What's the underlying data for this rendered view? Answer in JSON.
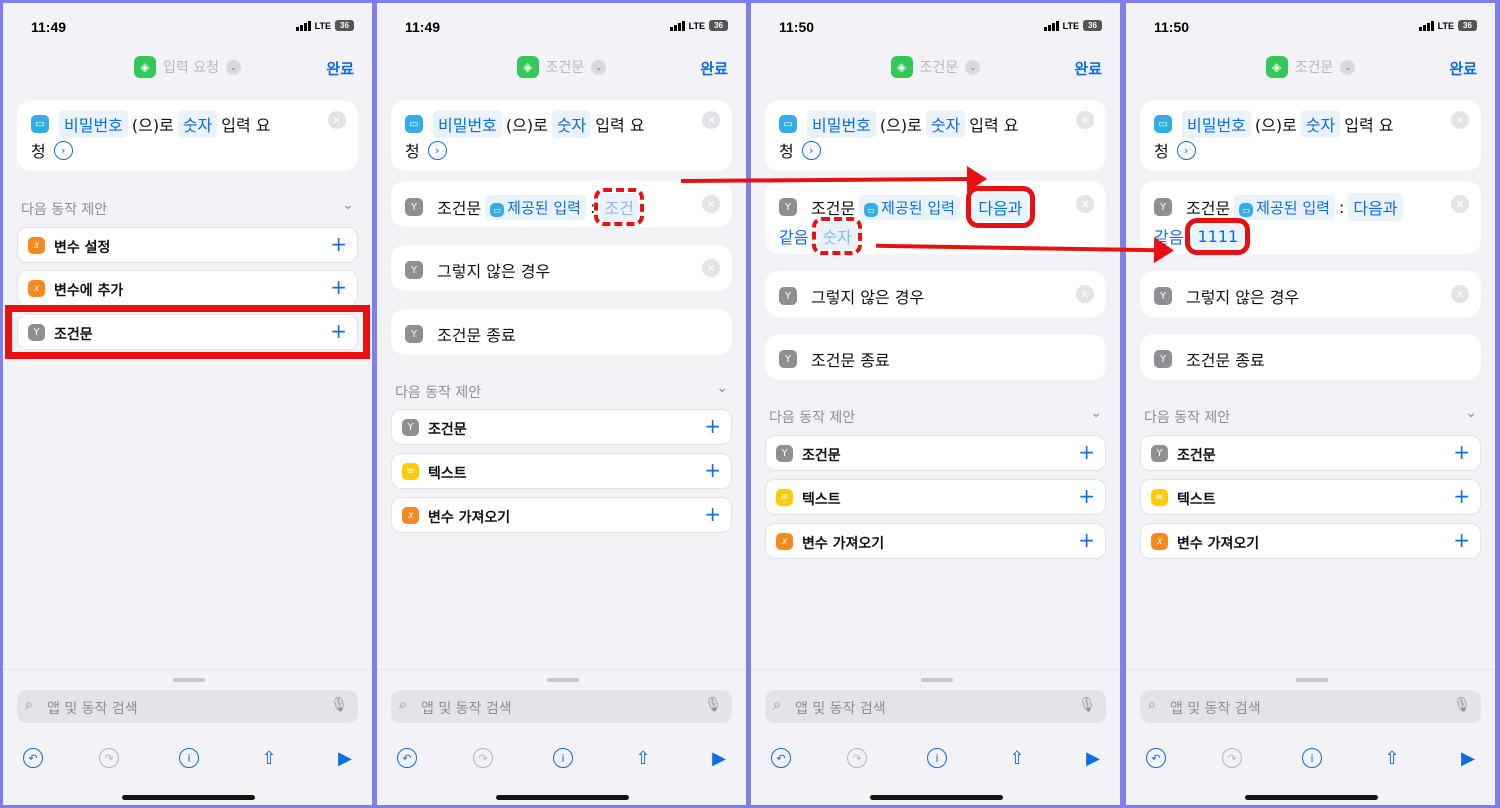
{
  "panels": [
    {
      "time": "11:49",
      "net": "LTE",
      "battery": "36",
      "nav_title": "입력 요청",
      "done": "완료",
      "ask": {
        "var": "비밀번호",
        "mid": "(으)로",
        "type": "숫자",
        "post1": "입력 요",
        "post2": "청"
      },
      "sugg_header": "다음 동작 제안",
      "suggestions": [
        {
          "label": "변수 설정",
          "icon": "variable-icon",
          "color": "#f6891f"
        },
        {
          "label": "변수에 추가",
          "icon": "variable-icon",
          "color": "#f6891f"
        },
        {
          "label": "조건문",
          "icon": "if-icon",
          "color": "#8e8e93"
        }
      ],
      "search_placeholder": "앱 및 동작 검색"
    },
    {
      "time": "11:49",
      "net": "LTE",
      "battery": "36",
      "nav_title": "조건문",
      "done": "완료",
      "ask": {
        "var": "비밀번호",
        "mid": "(으)로",
        "type": "숫자",
        "post1": "입력 요",
        "post2": "청"
      },
      "if_row": {
        "label": "조건문",
        "input": "제공된 입력",
        "colon": ":",
        "cond": "조건"
      },
      "else_label": "그렇지 않은 경우",
      "end_label": "조건문 종료",
      "sugg_header": "다음 동작 제안",
      "suggestions": [
        {
          "label": "조건문",
          "icon": "if-icon",
          "color": "#8e8e93"
        },
        {
          "label": "텍스트",
          "icon": "text-icon",
          "color": "#ffcc00"
        },
        {
          "label": "변수 가져오기",
          "icon": "variable-icon",
          "color": "#f6891f"
        }
      ],
      "search_placeholder": "앱 및 동작 검색"
    },
    {
      "time": "11:50",
      "net": "LTE",
      "battery": "36",
      "nav_title": "조건문",
      "done": "완료",
      "ask": {
        "var": "비밀번호",
        "mid": "(으)로",
        "type": "숫자",
        "post1": "입력 요",
        "post2": "청"
      },
      "if_row": {
        "label": "조건문",
        "input": "제공된 입력",
        "colon": ":",
        "cond1": "다음과",
        "cond2": "같음",
        "value": "숫자"
      },
      "else_label": "그렇지 않은 경우",
      "end_label": "조건문 종료",
      "sugg_header": "다음 동작 제안",
      "suggestions": [
        {
          "label": "조건문",
          "icon": "if-icon",
          "color": "#8e8e93"
        },
        {
          "label": "텍스트",
          "icon": "text-icon",
          "color": "#ffcc00"
        },
        {
          "label": "변수 가져오기",
          "icon": "variable-icon",
          "color": "#f6891f"
        }
      ],
      "search_placeholder": "앱 및 동작 검색"
    },
    {
      "time": "11:50",
      "net": "LTE",
      "battery": "36",
      "nav_title": "조건문",
      "done": "완료",
      "ask": {
        "var": "비밀번호",
        "mid": "(으)로",
        "type": "숫자",
        "post1": "입력 요",
        "post2": "청"
      },
      "if_row": {
        "label": "조건문",
        "input": "제공된 입력",
        "colon": ":",
        "cond1": "다음과",
        "cond2": "같음",
        "value": "1111"
      },
      "else_label": "그렇지 않은 경우",
      "end_label": "조건문 종료",
      "sugg_header": "다음 동작 제안",
      "suggestions": [
        {
          "label": "조건문",
          "icon": "if-icon",
          "color": "#8e8e93"
        },
        {
          "label": "텍스트",
          "icon": "text-icon",
          "color": "#ffcc00"
        },
        {
          "label": "변수 가져오기",
          "icon": "variable-icon",
          "color": "#f6891f"
        }
      ],
      "search_placeholder": "앱 및 동작 검색"
    }
  ],
  "colors": {
    "accent": "#0a6ee6",
    "highlight": "#e81010",
    "frame": "#7d7ff0",
    "app_green": "#34c759"
  }
}
